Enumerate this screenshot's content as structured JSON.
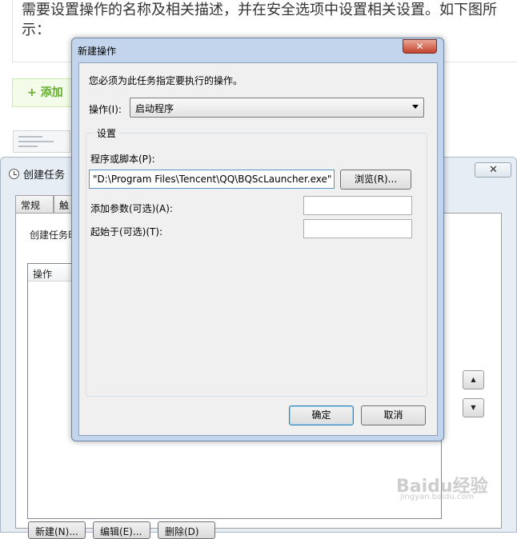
{
  "article": {
    "text": "需要设置操作的名称及相关描述，并在安全选项中设置相关设置。如下图所示：",
    "add_tip": "+ 添加"
  },
  "bg_window": {
    "title": "创建任务",
    "close": "✕",
    "tabs": [
      "常规",
      "触"
    ],
    "description": "创建任务时",
    "list_header": "操作",
    "up_arrow": "▲",
    "down_arrow": "▼",
    "bottom_buttons": [
      "新建(N)...",
      "编辑(E)...",
      "删除(D)"
    ]
  },
  "dialog": {
    "title": "新建操作",
    "close": "✕",
    "instruction": "您必须为此任务指定要执行的操作。",
    "action_label": "操作(I):",
    "action_value": "启动程序",
    "settings_label": "设置",
    "program_label": "程序或脚本(P):",
    "program_value": "\"D:\\Program Files\\Tencent\\QQ\\BQScLauncher.exe\"",
    "browse_button": "浏览(R)...",
    "args_label": "添加参数(可选)(A):",
    "args_value": "",
    "startin_label": "起始于(可选)(T):",
    "startin_value": "",
    "ok_button": "确定",
    "cancel_button": "取消"
  },
  "watermark": {
    "text": "Baidu经验",
    "url": "jingyan.baidu.com"
  }
}
